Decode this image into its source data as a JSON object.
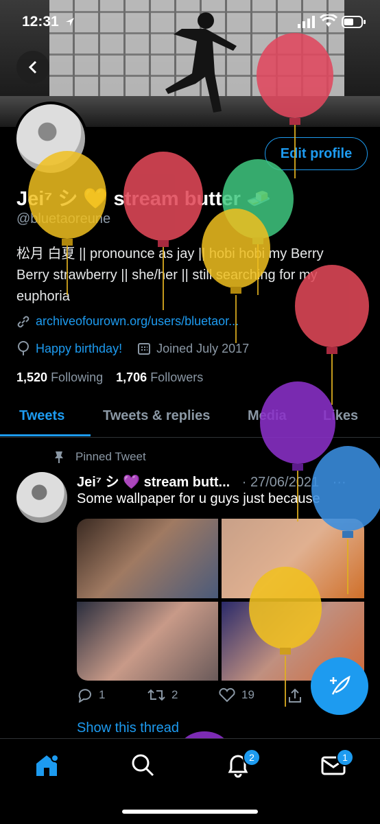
{
  "status_bar": {
    "time": "12:31"
  },
  "profile": {
    "edit_label": "Edit profile",
    "name": "Jei⁷ シ 💛 stream butter 🧈",
    "handle": "@bluetaoreune",
    "bio_line1": "松月 白夏 || pronounce as jay || hobi hobi my Berry",
    "bio_line2": "Berry strawberry || she/her || still searching for my",
    "bio_line3": "euphoria",
    "link": "archiveofourown.org/users/bluetaor...",
    "birthday": "Happy birthday!",
    "joined": "Joined July 2017",
    "following_count": "1,520",
    "following_label": "Following",
    "followers_count": "1,706",
    "followers_label": "Followers"
  },
  "tabs": [
    {
      "label": "Tweets"
    },
    {
      "label": "Tweets & replies"
    },
    {
      "label": "Media"
    },
    {
      "label": "Likes"
    }
  ],
  "tweet": {
    "pinned_label": "Pinned Tweet",
    "author": "Jei⁷ シ 💜 stream butt...",
    "date": "· 27/06/2021",
    "more": "···",
    "text": "Some wallpaper for u guys just because",
    "replies": "1",
    "retweets": "2",
    "likes": "19",
    "show_thread": "Show this thread"
  },
  "tabbar": {
    "notifications_badge": "2",
    "messages_badge": "1"
  },
  "colors": {
    "accent": "#1d9bf0",
    "muted": "#8b98a5"
  }
}
